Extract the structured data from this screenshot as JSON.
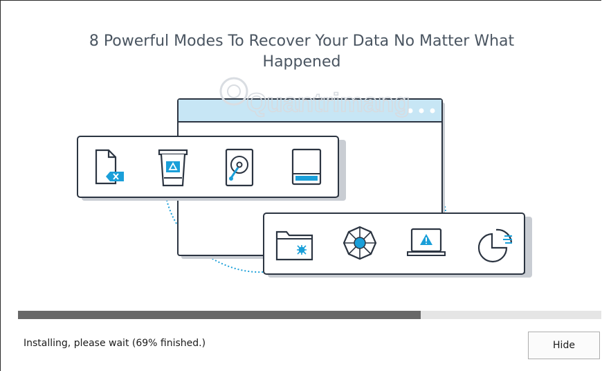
{
  "installer": {
    "headline_line1": "8 Powerful Modes To Recover Your Data No Matter What",
    "headline_line2": "Happened",
    "watermark": "Quantrimang",
    "progress_fraction": 0.69,
    "status_text": "Installing, please wait (69% finished.)",
    "hide_label": "Hide"
  },
  "icons": {
    "top_panel": [
      "deleted-file-icon",
      "recycle-bin-icon",
      "hard-disk-icon",
      "partition-icon"
    ],
    "bottom_panel": [
      "virus-folder-icon",
      "network-recovery-icon",
      "system-crash-icon",
      "raw-recovery-icon"
    ]
  },
  "colors": {
    "accent": "#1a9fd9",
    "outline": "#2b3441",
    "window_bar": "#c7e6f5",
    "progress_fill": "#676767",
    "progress_track": "#e5e5e5",
    "headline": "#4a5561"
  }
}
